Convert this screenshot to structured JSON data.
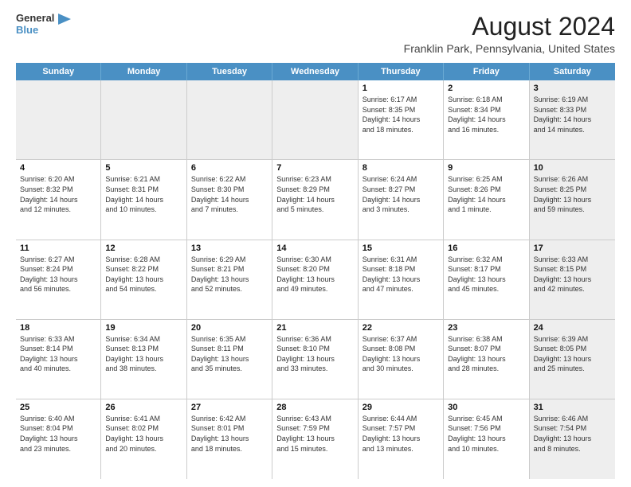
{
  "logo": {
    "line1": "General",
    "line2": "Blue",
    "icon_color": "#4a90c4"
  },
  "title": "August 2024",
  "subtitle": "Franklin Park, Pennsylvania, United States",
  "header_days": [
    "Sunday",
    "Monday",
    "Tuesday",
    "Wednesday",
    "Thursday",
    "Friday",
    "Saturday"
  ],
  "weeks": [
    [
      {
        "day": "",
        "info": "",
        "shaded": true
      },
      {
        "day": "",
        "info": "",
        "shaded": true
      },
      {
        "day": "",
        "info": "",
        "shaded": true
      },
      {
        "day": "",
        "info": "",
        "shaded": true
      },
      {
        "day": "1",
        "info": "Sunrise: 6:17 AM\nSunset: 8:35 PM\nDaylight: 14 hours\nand 18 minutes.",
        "shaded": false
      },
      {
        "day": "2",
        "info": "Sunrise: 6:18 AM\nSunset: 8:34 PM\nDaylight: 14 hours\nand 16 minutes.",
        "shaded": false
      },
      {
        "day": "3",
        "info": "Sunrise: 6:19 AM\nSunset: 8:33 PM\nDaylight: 14 hours\nand 14 minutes.",
        "shaded": true
      }
    ],
    [
      {
        "day": "4",
        "info": "Sunrise: 6:20 AM\nSunset: 8:32 PM\nDaylight: 14 hours\nand 12 minutes.",
        "shaded": false
      },
      {
        "day": "5",
        "info": "Sunrise: 6:21 AM\nSunset: 8:31 PM\nDaylight: 14 hours\nand 10 minutes.",
        "shaded": false
      },
      {
        "day": "6",
        "info": "Sunrise: 6:22 AM\nSunset: 8:30 PM\nDaylight: 14 hours\nand 7 minutes.",
        "shaded": false
      },
      {
        "day": "7",
        "info": "Sunrise: 6:23 AM\nSunset: 8:29 PM\nDaylight: 14 hours\nand 5 minutes.",
        "shaded": false
      },
      {
        "day": "8",
        "info": "Sunrise: 6:24 AM\nSunset: 8:27 PM\nDaylight: 14 hours\nand 3 minutes.",
        "shaded": false
      },
      {
        "day": "9",
        "info": "Sunrise: 6:25 AM\nSunset: 8:26 PM\nDaylight: 14 hours\nand 1 minute.",
        "shaded": false
      },
      {
        "day": "10",
        "info": "Sunrise: 6:26 AM\nSunset: 8:25 PM\nDaylight: 13 hours\nand 59 minutes.",
        "shaded": true
      }
    ],
    [
      {
        "day": "11",
        "info": "Sunrise: 6:27 AM\nSunset: 8:24 PM\nDaylight: 13 hours\nand 56 minutes.",
        "shaded": false
      },
      {
        "day": "12",
        "info": "Sunrise: 6:28 AM\nSunset: 8:22 PM\nDaylight: 13 hours\nand 54 minutes.",
        "shaded": false
      },
      {
        "day": "13",
        "info": "Sunrise: 6:29 AM\nSunset: 8:21 PM\nDaylight: 13 hours\nand 52 minutes.",
        "shaded": false
      },
      {
        "day": "14",
        "info": "Sunrise: 6:30 AM\nSunset: 8:20 PM\nDaylight: 13 hours\nand 49 minutes.",
        "shaded": false
      },
      {
        "day": "15",
        "info": "Sunrise: 6:31 AM\nSunset: 8:18 PM\nDaylight: 13 hours\nand 47 minutes.",
        "shaded": false
      },
      {
        "day": "16",
        "info": "Sunrise: 6:32 AM\nSunset: 8:17 PM\nDaylight: 13 hours\nand 45 minutes.",
        "shaded": false
      },
      {
        "day": "17",
        "info": "Sunrise: 6:33 AM\nSunset: 8:15 PM\nDaylight: 13 hours\nand 42 minutes.",
        "shaded": true
      }
    ],
    [
      {
        "day": "18",
        "info": "Sunrise: 6:33 AM\nSunset: 8:14 PM\nDaylight: 13 hours\nand 40 minutes.",
        "shaded": false
      },
      {
        "day": "19",
        "info": "Sunrise: 6:34 AM\nSunset: 8:13 PM\nDaylight: 13 hours\nand 38 minutes.",
        "shaded": false
      },
      {
        "day": "20",
        "info": "Sunrise: 6:35 AM\nSunset: 8:11 PM\nDaylight: 13 hours\nand 35 minutes.",
        "shaded": false
      },
      {
        "day": "21",
        "info": "Sunrise: 6:36 AM\nSunset: 8:10 PM\nDaylight: 13 hours\nand 33 minutes.",
        "shaded": false
      },
      {
        "day": "22",
        "info": "Sunrise: 6:37 AM\nSunset: 8:08 PM\nDaylight: 13 hours\nand 30 minutes.",
        "shaded": false
      },
      {
        "day": "23",
        "info": "Sunrise: 6:38 AM\nSunset: 8:07 PM\nDaylight: 13 hours\nand 28 minutes.",
        "shaded": false
      },
      {
        "day": "24",
        "info": "Sunrise: 6:39 AM\nSunset: 8:05 PM\nDaylight: 13 hours\nand 25 minutes.",
        "shaded": true
      }
    ],
    [
      {
        "day": "25",
        "info": "Sunrise: 6:40 AM\nSunset: 8:04 PM\nDaylight: 13 hours\nand 23 minutes.",
        "shaded": false
      },
      {
        "day": "26",
        "info": "Sunrise: 6:41 AM\nSunset: 8:02 PM\nDaylight: 13 hours\nand 20 minutes.",
        "shaded": false
      },
      {
        "day": "27",
        "info": "Sunrise: 6:42 AM\nSunset: 8:01 PM\nDaylight: 13 hours\nand 18 minutes.",
        "shaded": false
      },
      {
        "day": "28",
        "info": "Sunrise: 6:43 AM\nSunset: 7:59 PM\nDaylight: 13 hours\nand 15 minutes.",
        "shaded": false
      },
      {
        "day": "29",
        "info": "Sunrise: 6:44 AM\nSunset: 7:57 PM\nDaylight: 13 hours\nand 13 minutes.",
        "shaded": false
      },
      {
        "day": "30",
        "info": "Sunrise: 6:45 AM\nSunset: 7:56 PM\nDaylight: 13 hours\nand 10 minutes.",
        "shaded": false
      },
      {
        "day": "31",
        "info": "Sunrise: 6:46 AM\nSunset: 7:54 PM\nDaylight: 13 hours\nand 8 minutes.",
        "shaded": true
      }
    ]
  ]
}
